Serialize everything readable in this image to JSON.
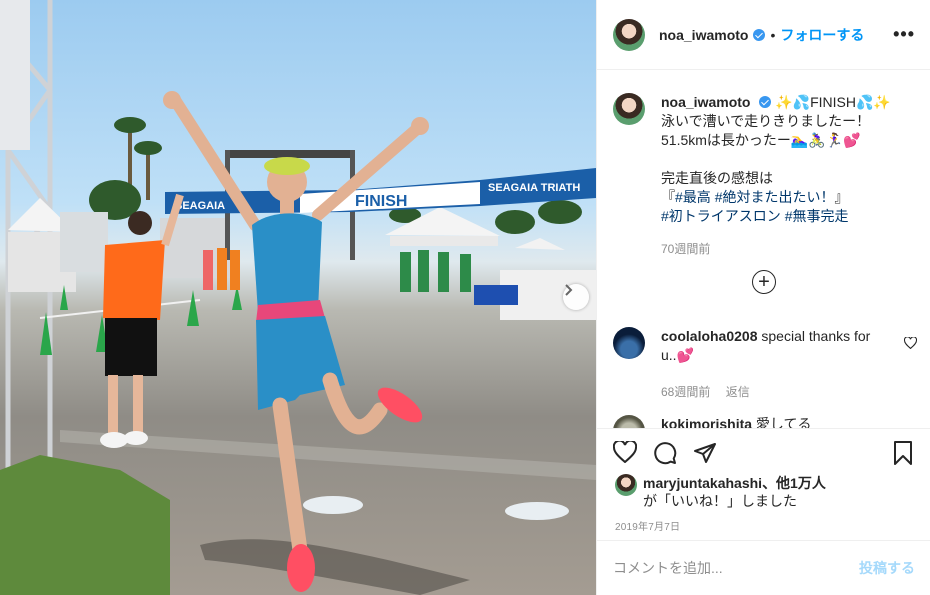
{
  "post": {
    "username": "noa_iwamoto",
    "follow_label": "フォローする",
    "separator": "•",
    "more_label": "•••"
  },
  "photo": {
    "banner_left": "SEAGAIA",
    "banner_center": "FINISH",
    "banner_right": "SEAGAIA TRIATH",
    "next_icon": "chevron-right-icon"
  },
  "caption": {
    "username": "noa_iwamoto",
    "lines": [
      "✨💦FINISH💦✨",
      "泳いで漕いで走りきりましたー！",
      "51.5kmは長かったー🏊‍♀️🚴‍♀️🏃‍♀️💕"
    ],
    "line4": "完走直後の感想は",
    "line5_prefix": "『",
    "tag1": "#最高",
    "tag2": "#絶対また出たい！",
    "line5_suffix": "』",
    "tag3": "#初トライアスロン",
    "tag4": "#無事完走",
    "time": "70週間前"
  },
  "load_more_label": "+",
  "comments": [
    {
      "username": "coolaloha0208",
      "text": "special thanks for u..💕",
      "time": "68週間前",
      "reply_label": "返信"
    },
    {
      "username": "kokimorishita",
      "text": "愛してる"
    }
  ],
  "actions": {
    "like_icon": "heart-icon",
    "comment_icon": "comment-icon",
    "share_icon": "share-icon",
    "save_icon": "bookmark-icon"
  },
  "likes": {
    "user": "maryjuntakahashi",
    "others": "、他1万人",
    "suffix": "が「いいね！」しました"
  },
  "date": "2019年7月7日",
  "add_comment": {
    "placeholder": "コメントを追加...",
    "post_label": "投稿する"
  },
  "colors": {
    "accent": "#0095f6",
    "tag": "#00376b",
    "muted": "#8e8e8e",
    "heart": "#ed4956"
  }
}
